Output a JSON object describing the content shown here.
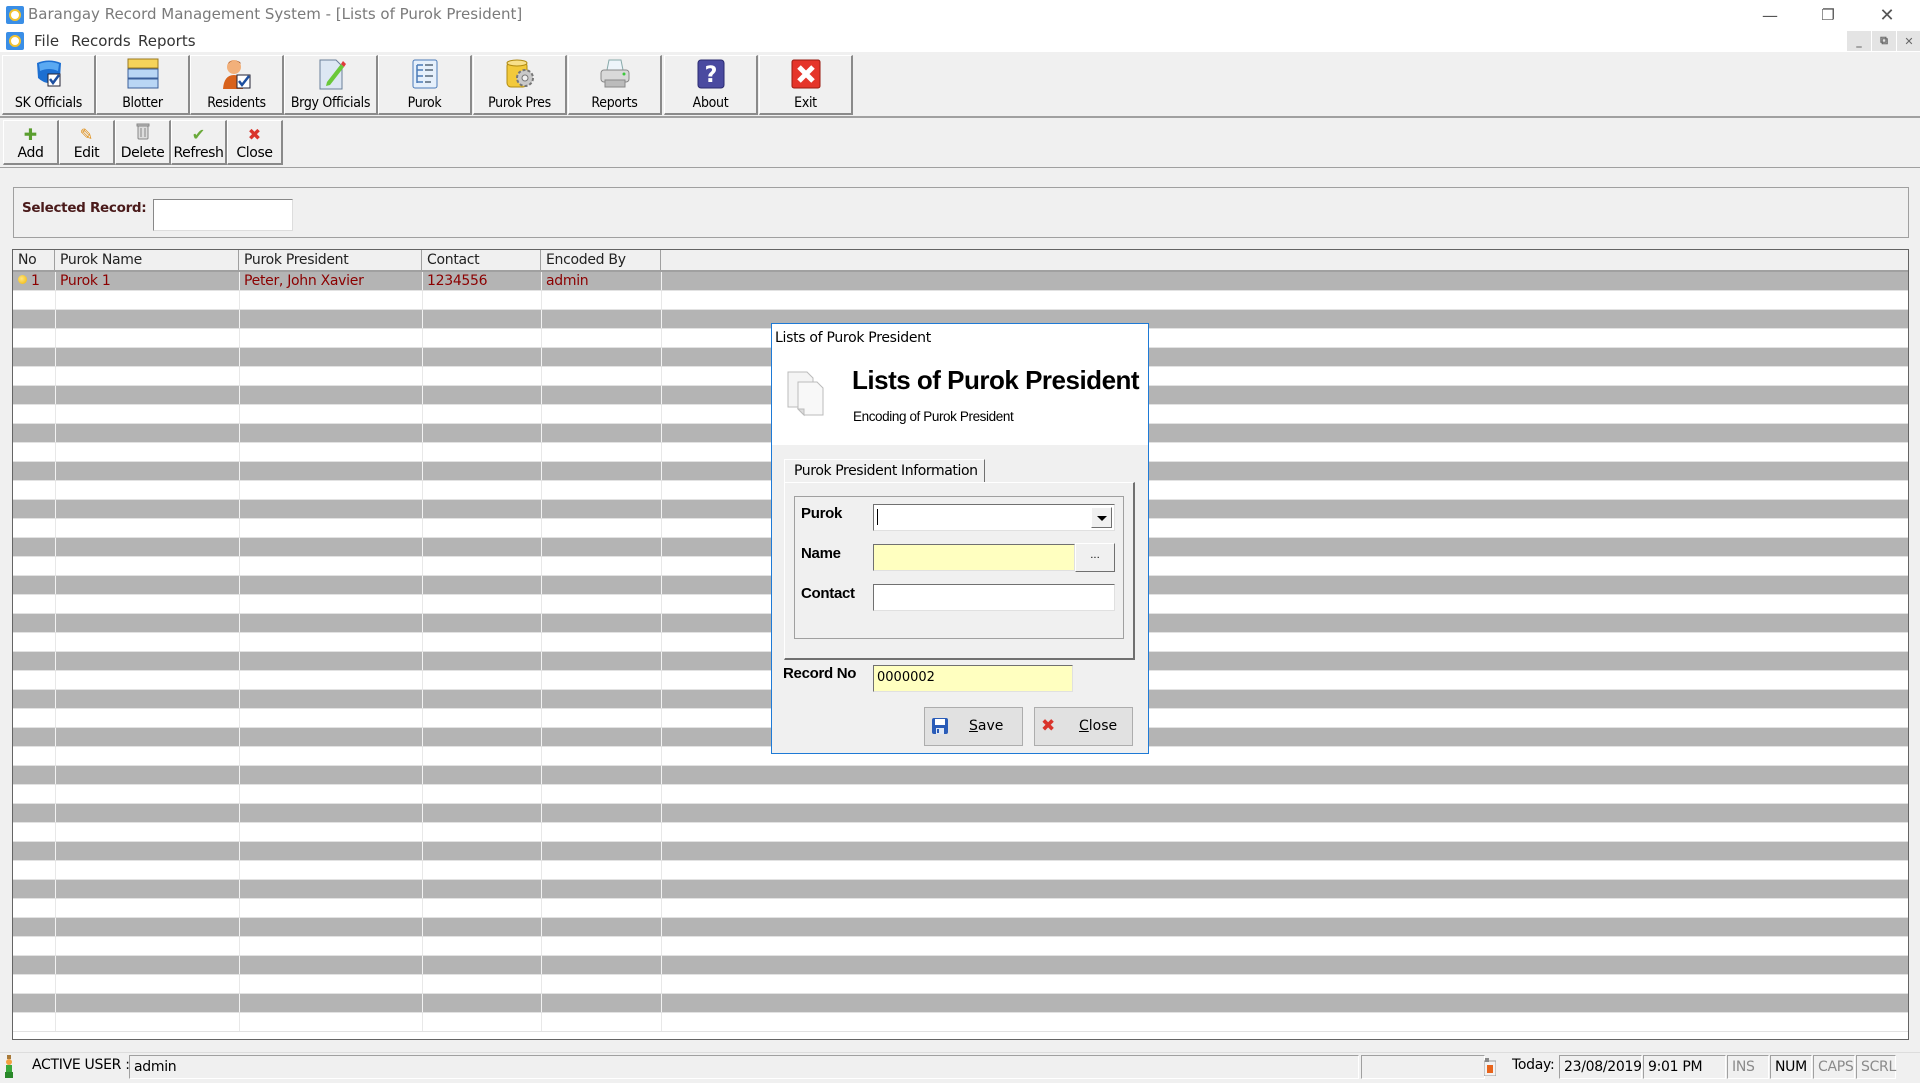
{
  "window": {
    "title": "Barangay Record Management System - [Lists of Purok President]",
    "controls": {
      "minimize": "—",
      "restore": "❐",
      "close": "✕"
    }
  },
  "menu": {
    "items": [
      "File",
      "Records",
      "Reports"
    ],
    "mdi_controls": {
      "minimize": "_",
      "restore": "⧉",
      "close": "✕"
    }
  },
  "main_toolbar": {
    "buttons": [
      {
        "label": "SK Officials",
        "icon": "shield-check-icon"
      },
      {
        "label": "Blotter",
        "icon": "stacked-list-icon"
      },
      {
        "label": "Residents",
        "icon": "user-check-icon"
      },
      {
        "label": "Brgy Officials",
        "icon": "document-edit-icon"
      },
      {
        "label": "Purok",
        "icon": "tree-list-icon"
      },
      {
        "label": "Purok Pres",
        "icon": "database-gear-icon"
      },
      {
        "label": "Reports",
        "icon": "printer-icon"
      },
      {
        "label": "About",
        "icon": "help-icon"
      },
      {
        "label": "Exit",
        "icon": "exit-icon"
      }
    ]
  },
  "sub_toolbar": {
    "buttons": [
      {
        "label": "Add",
        "icon": "plus-icon",
        "glyph": "✚",
        "color": "#5a9e2f"
      },
      {
        "label": "Edit",
        "icon": "pencil-icon",
        "glyph": "✎",
        "color": "#e0901a"
      },
      {
        "label": "Delete",
        "icon": "trash-icon",
        "glyph": "🗑",
        "color": "#999999"
      },
      {
        "label": "Refresh",
        "icon": "check-icon",
        "glyph": "✔",
        "color": "#6aaa3a"
      },
      {
        "label": "Close",
        "icon": "close-icon",
        "glyph": "✖",
        "color": "#d9342b"
      }
    ]
  },
  "selected_record": {
    "label": "Selected Record:",
    "value": ""
  },
  "grid": {
    "columns": [
      "No",
      "Purok Name",
      "Purok President",
      "Contact",
      "Encoded By"
    ],
    "rows": [
      {
        "no": "1",
        "purok_name": "Purok 1",
        "purok_president": "Peter, John Xavier",
        "contact": "1234556",
        "encoded_by": "admin"
      }
    ],
    "row_colors": {
      "odd": "#b4b4b4",
      "even": "#ffffff",
      "text": "#8b0000"
    }
  },
  "dialog": {
    "window_title": "Lists of Purok President",
    "heading": "Lists of Purok President",
    "subheading": "Encoding of Purok President",
    "tab_label": "Purok President Information",
    "fields": {
      "purok": {
        "label": "Purok",
        "value": ""
      },
      "name": {
        "label": "Name",
        "value": "",
        "lookup_label": "..."
      },
      "contact": {
        "label": "Contact",
        "value": ""
      },
      "record_no": {
        "label": "Record No",
        "value": "0000002"
      }
    },
    "buttons": {
      "save": {
        "label": "Save",
        "mnemonic": "S"
      },
      "close": {
        "label": "Close",
        "mnemonic": "C"
      }
    }
  },
  "status_bar": {
    "active_user_label": "ACTIVE USER :",
    "active_user": "admin",
    "today_label": "Today:",
    "date": "23/08/2019",
    "time": "9:01 PM",
    "indicators": [
      {
        "label": "INS",
        "active": false
      },
      {
        "label": "NUM",
        "active": true
      },
      {
        "label": "CAPS",
        "active": false
      },
      {
        "label": "SCRL",
        "active": false
      }
    ]
  }
}
